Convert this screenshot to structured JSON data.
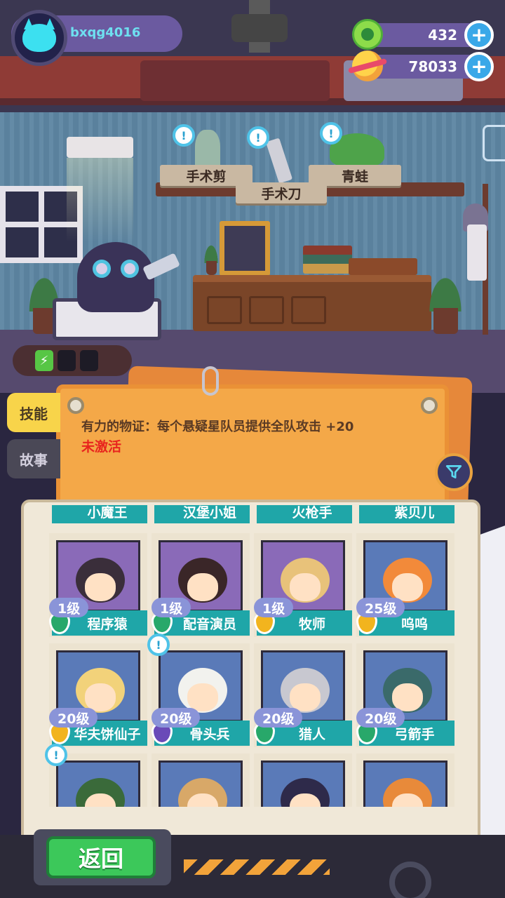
{
  "player": {
    "username": "bxqg4016"
  },
  "currencies": [
    {
      "name": "gems",
      "value": "432",
      "icon": "gem-icon"
    },
    {
      "name": "coins",
      "value": "78033",
      "icon": "planet-coin-icon"
    }
  ],
  "shelf": {
    "items": [
      {
        "label": "手术剪"
      },
      {
        "label": "手术刀"
      },
      {
        "label": "青蛙"
      }
    ]
  },
  "tabs": [
    {
      "label": "技能",
      "active": true
    },
    {
      "label": "故事",
      "active": false
    }
  ],
  "skill": {
    "description": "有力的物证：每个悬疑星队员提供全队攻击 +20",
    "status": "未激活"
  },
  "partial_row": [
    "小魔王",
    "汉堡小姐",
    "火枪手",
    "紫贝儿"
  ],
  "characters": [
    {
      "name": "程序猿",
      "level": "1级",
      "rank_color": "#28a86a",
      "bg": "#8a6ab8",
      "hair": "#3a2e3a",
      "notify": false
    },
    {
      "name": "配音演员",
      "level": "1级",
      "rank_color": "#28a86a",
      "bg": "#8a6ab8",
      "hair": "#3a2628",
      "notify": false
    },
    {
      "name": "牧师",
      "level": "1级",
      "rank_color": "#f2b41e",
      "bg": "#8a6ab8",
      "hair": "#e8c27a",
      "notify": false
    },
    {
      "name": "呜呜",
      "level": "25级",
      "rank_color": "#f2b41e",
      "bg": "#5a7ab8",
      "hair": "#f28a3a",
      "notify": false
    },
    {
      "name": "华夫饼仙子",
      "level": "20级",
      "rank_color": "#f2b41e",
      "bg": "#5a7ab8",
      "hair": "#f2d27a",
      "notify": false
    },
    {
      "name": "骨头兵",
      "level": "20级",
      "rank_color": "#6a4ab8",
      "bg": "#5a7ab8",
      "hair": "#f2f2ee",
      "notify": true
    },
    {
      "name": "猎人",
      "level": "20级",
      "rank_color": "#28a86a",
      "bg": "#5a7ab8",
      "hair": "#c8c8d0",
      "notify": false
    },
    {
      "name": "弓箭手",
      "level": "20级",
      "rank_color": "#28a86a",
      "bg": "#5a7ab8",
      "hair": "#3a6a6a",
      "notify": false
    },
    {
      "name": "",
      "level": "",
      "rank_color": "#28a86a",
      "bg": "#5a7ab8",
      "hair": "#3a6a3a",
      "notify": true
    },
    {
      "name": "",
      "level": "",
      "rank_color": "#28a86a",
      "bg": "#5a7ab8",
      "hair": "#d8a868",
      "notify": false
    },
    {
      "name": "",
      "level": "",
      "rank_color": "#28a86a",
      "bg": "#5a7ab8",
      "hair": "#2e2a4a",
      "notify": false
    },
    {
      "name": "",
      "level": "",
      "rank_color": "#28a86a",
      "bg": "#5a7ab8",
      "hair": "#e88a3a",
      "notify": false
    }
  ],
  "buttons": {
    "back": "返回"
  },
  "colors": {
    "accent_green": "#3cc85a",
    "board_orange": "#f4a848",
    "inactive_red": "#e8241e"
  }
}
